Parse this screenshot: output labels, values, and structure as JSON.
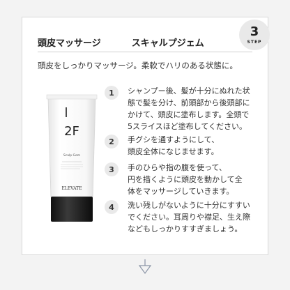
{
  "header": {
    "title_left": "頭皮マッサージ",
    "title_right": "スキャルプジェム",
    "step_number": "3",
    "step_label": "STEP"
  },
  "lead": "頭皮をしっかりマッサージ。柔軟でハリのある状態に。",
  "product": {
    "brand": "ELEVATE",
    "code": "2F",
    "name": "Scalp Gem"
  },
  "steps": [
    {
      "num": "1",
      "lines": [
        "シャンプー後、髪が十分にぬれた状",
        "態で髪を分け、前頭部から後頭部に",
        "かけて、頭皮に塗布します。全頭で",
        "5スライスほど塗布してください。"
      ]
    },
    {
      "num": "2",
      "lines": [
        "手グシを通すようにして、",
        "頭皮全体になじませます。"
      ]
    },
    {
      "num": "3",
      "lines": [
        "手のひらや指の腹を使って、",
        "円を描くように頭皮を動かして全",
        "体をマッサージしていきます。"
      ]
    },
    {
      "num": "4",
      "lines": [
        "洗い残しがないように十分にすすい",
        "でください。耳周りや襟足、生え際",
        "などもしっかりすすぎましょう。"
      ]
    }
  ],
  "colors": {
    "background": "#f3f3f3",
    "card": "#ffffff",
    "badge": "#e9e9e9",
    "arrow": "#8a94a6"
  }
}
